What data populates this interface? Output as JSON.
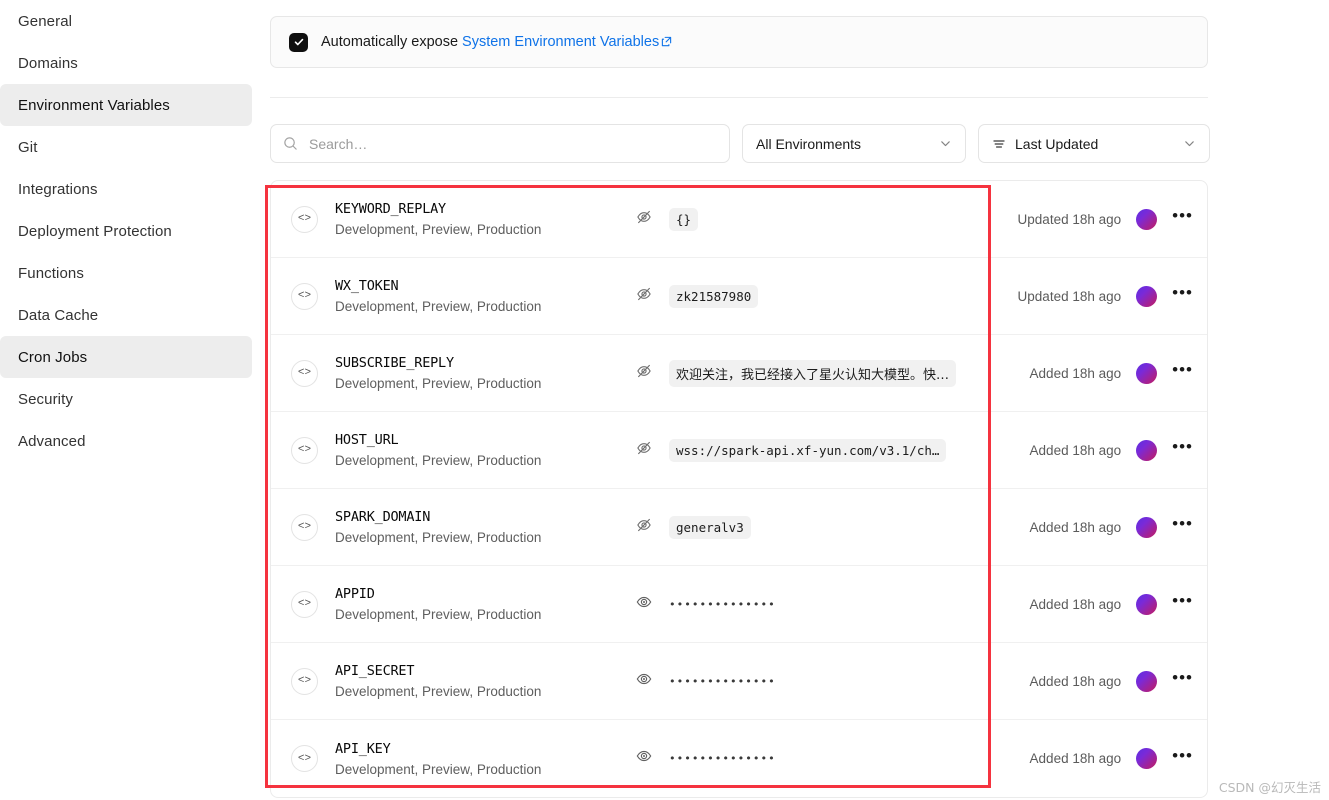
{
  "sidebar": {
    "items": [
      {
        "label": "General",
        "active": false
      },
      {
        "label": "Domains",
        "active": false
      },
      {
        "label": "Environment Variables",
        "active": true
      },
      {
        "label": "Git",
        "active": false
      },
      {
        "label": "Integrations",
        "active": false
      },
      {
        "label": "Deployment Protection",
        "active": false
      },
      {
        "label": "Functions",
        "active": false
      },
      {
        "label": "Data Cache",
        "active": false
      },
      {
        "label": "Cron Jobs",
        "active": true
      },
      {
        "label": "Security",
        "active": false
      },
      {
        "label": "Advanced",
        "active": false
      }
    ]
  },
  "banner": {
    "checked": true,
    "text_prefix": "Automatically expose ",
    "link_label": "System Environment Variables",
    "link_icon": "external-link-icon",
    "checkbox_icon": "check-icon"
  },
  "controls": {
    "search": {
      "placeholder": "Search…",
      "value": "",
      "icon": "search-icon"
    },
    "environment_filter": {
      "value": "All Environments",
      "icon": "chevron-down-icon"
    },
    "sort_filter": {
      "value": "Last Updated",
      "leading_icon": "sort-lines-icon",
      "icon": "chevron-down-icon"
    }
  },
  "table": {
    "rows": [
      {
        "badge_icon": "code-brackets-icon",
        "name": "KEYWORD_REPLAY",
        "environments": "Development, Preview, Production",
        "visibility_icon": "eye-off-icon",
        "value": "{}",
        "value_type": "chip",
        "meta": "Updated 18h ago",
        "avatar": "user-avatar",
        "menu_icon": "more-horizontal-icon"
      },
      {
        "badge_icon": "code-brackets-icon",
        "name": "WX_TOKEN",
        "environments": "Development, Preview, Production",
        "visibility_icon": "eye-off-icon",
        "value": "zk21587980",
        "value_type": "chip",
        "meta": "Updated 18h ago",
        "avatar": "user-avatar",
        "menu_icon": "more-horizontal-icon"
      },
      {
        "badge_icon": "code-brackets-icon",
        "name": "SUBSCRIBE_REPLY",
        "environments": "Development, Preview, Production",
        "visibility_icon": "eye-off-icon",
        "value": "欢迎关注，我已经接入了星火认知大模型。快…",
        "value_type": "chip-cjk",
        "meta": "Added 18h ago",
        "avatar": "user-avatar",
        "menu_icon": "more-horizontal-icon"
      },
      {
        "badge_icon": "code-brackets-icon",
        "name": "HOST_URL",
        "environments": "Development, Preview, Production",
        "visibility_icon": "eye-off-icon",
        "value": "wss://spark-api.xf-yun.com/v3.1/ch…",
        "value_type": "chip",
        "meta": "Added 18h ago",
        "avatar": "user-avatar",
        "menu_icon": "more-horizontal-icon"
      },
      {
        "badge_icon": "code-brackets-icon",
        "name": "SPARK_DOMAIN",
        "environments": "Development, Preview, Production",
        "visibility_icon": "eye-off-icon",
        "value": "generalv3",
        "value_type": "chip",
        "meta": "Added 18h ago",
        "avatar": "user-avatar",
        "menu_icon": "more-horizontal-icon"
      },
      {
        "badge_icon": "code-brackets-icon",
        "name": "APPID",
        "environments": "Development, Preview, Production",
        "visibility_icon": "eye-icon",
        "value": "••••••••••••••",
        "value_type": "mask",
        "meta": "Added 18h ago",
        "avatar": "user-avatar",
        "menu_icon": "more-horizontal-icon"
      },
      {
        "badge_icon": "code-brackets-icon",
        "name": "API_SECRET",
        "environments": "Development, Preview, Production",
        "visibility_icon": "eye-icon",
        "value": "••••••••••••••",
        "value_type": "mask",
        "meta": "Added 18h ago",
        "avatar": "user-avatar",
        "menu_icon": "more-horizontal-icon"
      },
      {
        "badge_icon": "code-brackets-icon",
        "name": "API_KEY",
        "environments": "Development, Preview, Production",
        "visibility_icon": "eye-icon",
        "value": "••••••••••••••",
        "value_type": "mask",
        "meta": "Added 18h ago",
        "avatar": "user-avatar",
        "menu_icon": "more-horizontal-icon"
      }
    ]
  },
  "annotation": {
    "highlight_color": "#f5333f"
  },
  "watermark": {
    "text": "CSDN @幻灭生活"
  },
  "colors": {
    "link": "#0f73e8",
    "sidebar_active_bg": "#ededed",
    "avatar_start": "#5b2fe0",
    "avatar_end": "#c41c5e",
    "highlight": "#f5333f"
  }
}
